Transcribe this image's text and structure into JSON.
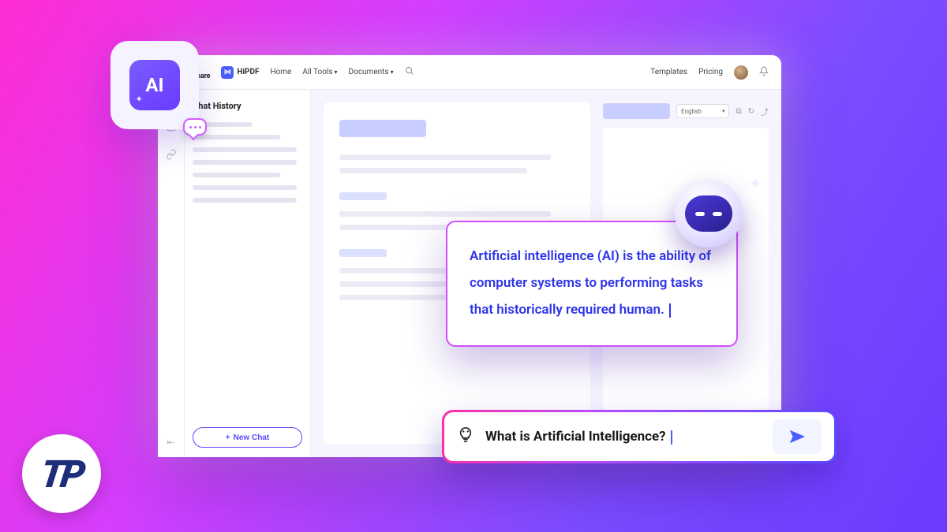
{
  "topnav": {
    "brand": "wondershare",
    "hipdf": "HiPDF",
    "home": "Home",
    "all_tools": "All Tools",
    "documents": "Documents",
    "templates": "Templates",
    "pricing": "Pricing"
  },
  "sidebar": {
    "chat_history_label": "Chat History",
    "new_chat_label": "New Chat"
  },
  "toolbar": {
    "language": "English"
  },
  "ai_badge": {
    "label": "AI"
  },
  "response": {
    "text": "Artificial intelligence (AI) is the ability of computer systems to performing tasks that historically required human."
  },
  "prompt": {
    "text": "What is Artificial Intelligence?"
  },
  "tp_logo": {
    "text": "TP"
  }
}
